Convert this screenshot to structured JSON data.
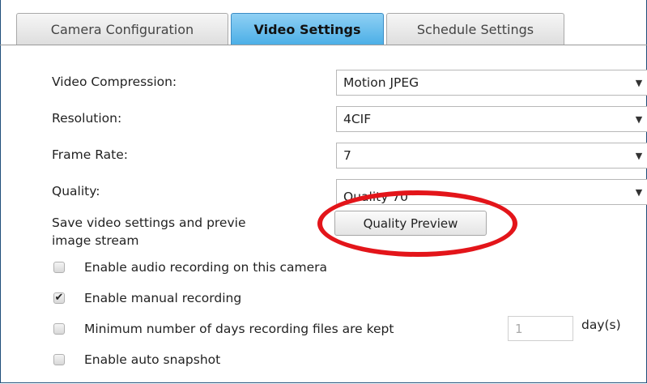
{
  "tabs": {
    "camera_configuration": "Camera Configuration",
    "video_settings": "Video Settings",
    "schedule_settings": "Schedule Settings"
  },
  "form": {
    "video_compression": {
      "label": "Video Compression:",
      "value": "Motion JPEG"
    },
    "resolution": {
      "label": "Resolution:",
      "value": "4CIF"
    },
    "frame_rate": {
      "label": "Frame Rate:",
      "value": "7"
    },
    "quality": {
      "label": "Quality:",
      "value": "Quality 70"
    },
    "preview_text_line1": "Save video settings and previe",
    "preview_text_line2": "image stream",
    "preview_button": "Quality Preview"
  },
  "options": {
    "audio_recording": {
      "label": "Enable audio recording on this camera",
      "checked": false
    },
    "manual_recording": {
      "label": "Enable manual recording",
      "checked": true
    },
    "min_days": {
      "label": "Minimum number of days recording files are kept",
      "checked": false,
      "placeholder": "1",
      "unit": "day(s)"
    },
    "auto_snapshot": {
      "label": "Enable auto snapshot",
      "checked": false
    }
  },
  "colors": {
    "active_tab": "#4aaee6",
    "annotation_ring": "#e3151a",
    "frame_border": "#1f4f7a"
  },
  "icons": {
    "dropdown": "chevron-down-icon",
    "check": "checkmark-icon"
  }
}
